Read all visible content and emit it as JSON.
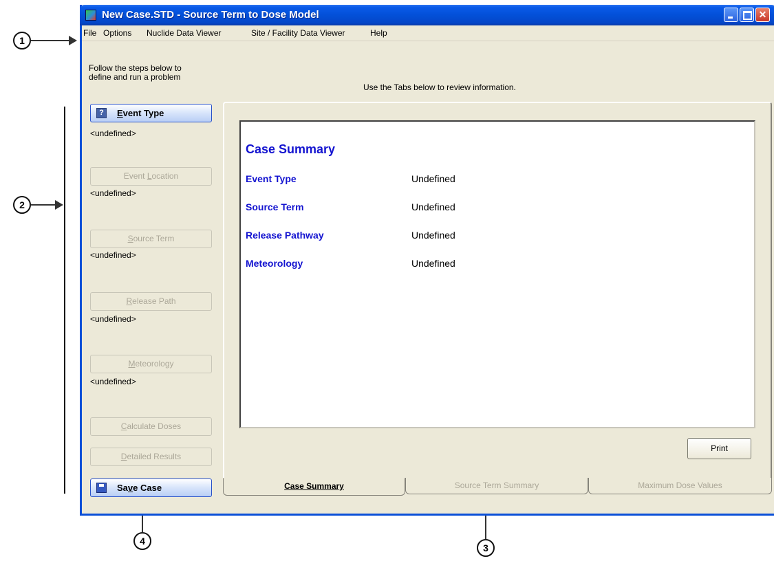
{
  "window": {
    "title": "New Case.STD - Source Term to Dose Model"
  },
  "menu": [
    "File",
    "Options",
    "Nuclide Data Viewer",
    "Site / Facility Data Viewer",
    "Help"
  ],
  "instructions": {
    "left_line1": "Follow the steps below to",
    "left_line2": "define and run a problem",
    "right": "Use the Tabs below to review information."
  },
  "steps": {
    "event_type": {
      "label_prefix": "E",
      "label_rest": "vent Type",
      "value": "<undefined>"
    },
    "event_location": {
      "label_a": "Event ",
      "label_u": "L",
      "label_b": "ocation",
      "value": "<undefined>"
    },
    "source_term": {
      "label_u": "S",
      "label_b": "ource Term",
      "value": "<undefined>"
    },
    "release_path": {
      "label_u": "R",
      "label_b": "elease Path",
      "value": "<undefined>"
    },
    "meteorology": {
      "label_u": "M",
      "label_b": "eteorology",
      "value": "<undefined>"
    },
    "calculate_doses": {
      "label_u": "C",
      "label_b": "alculate Doses"
    },
    "detailed_results": {
      "label_u": "D",
      "label_b": "etailed Results"
    },
    "save_case": {
      "label_a": "Sa",
      "label_u": "v",
      "label_b": "e Case"
    }
  },
  "summary": {
    "title": "Case Summary",
    "rows": [
      {
        "label": "Event Type",
        "value": "Undefined"
      },
      {
        "label": "Source Term",
        "value": "Undefined"
      },
      {
        "label": "Release Pathway",
        "value": "Undefined"
      },
      {
        "label": "Meteorology",
        "value": "Undefined"
      }
    ],
    "print_label": "Print"
  },
  "tabs": [
    "Case Summary",
    "Source Term Summary",
    "Maximum Dose Values"
  ],
  "callouts": [
    "1",
    "2",
    "3",
    "4"
  ],
  "icons": {
    "app": "app-icon",
    "event_type": "help-question-icon",
    "save": "floppy-disk-icon"
  }
}
